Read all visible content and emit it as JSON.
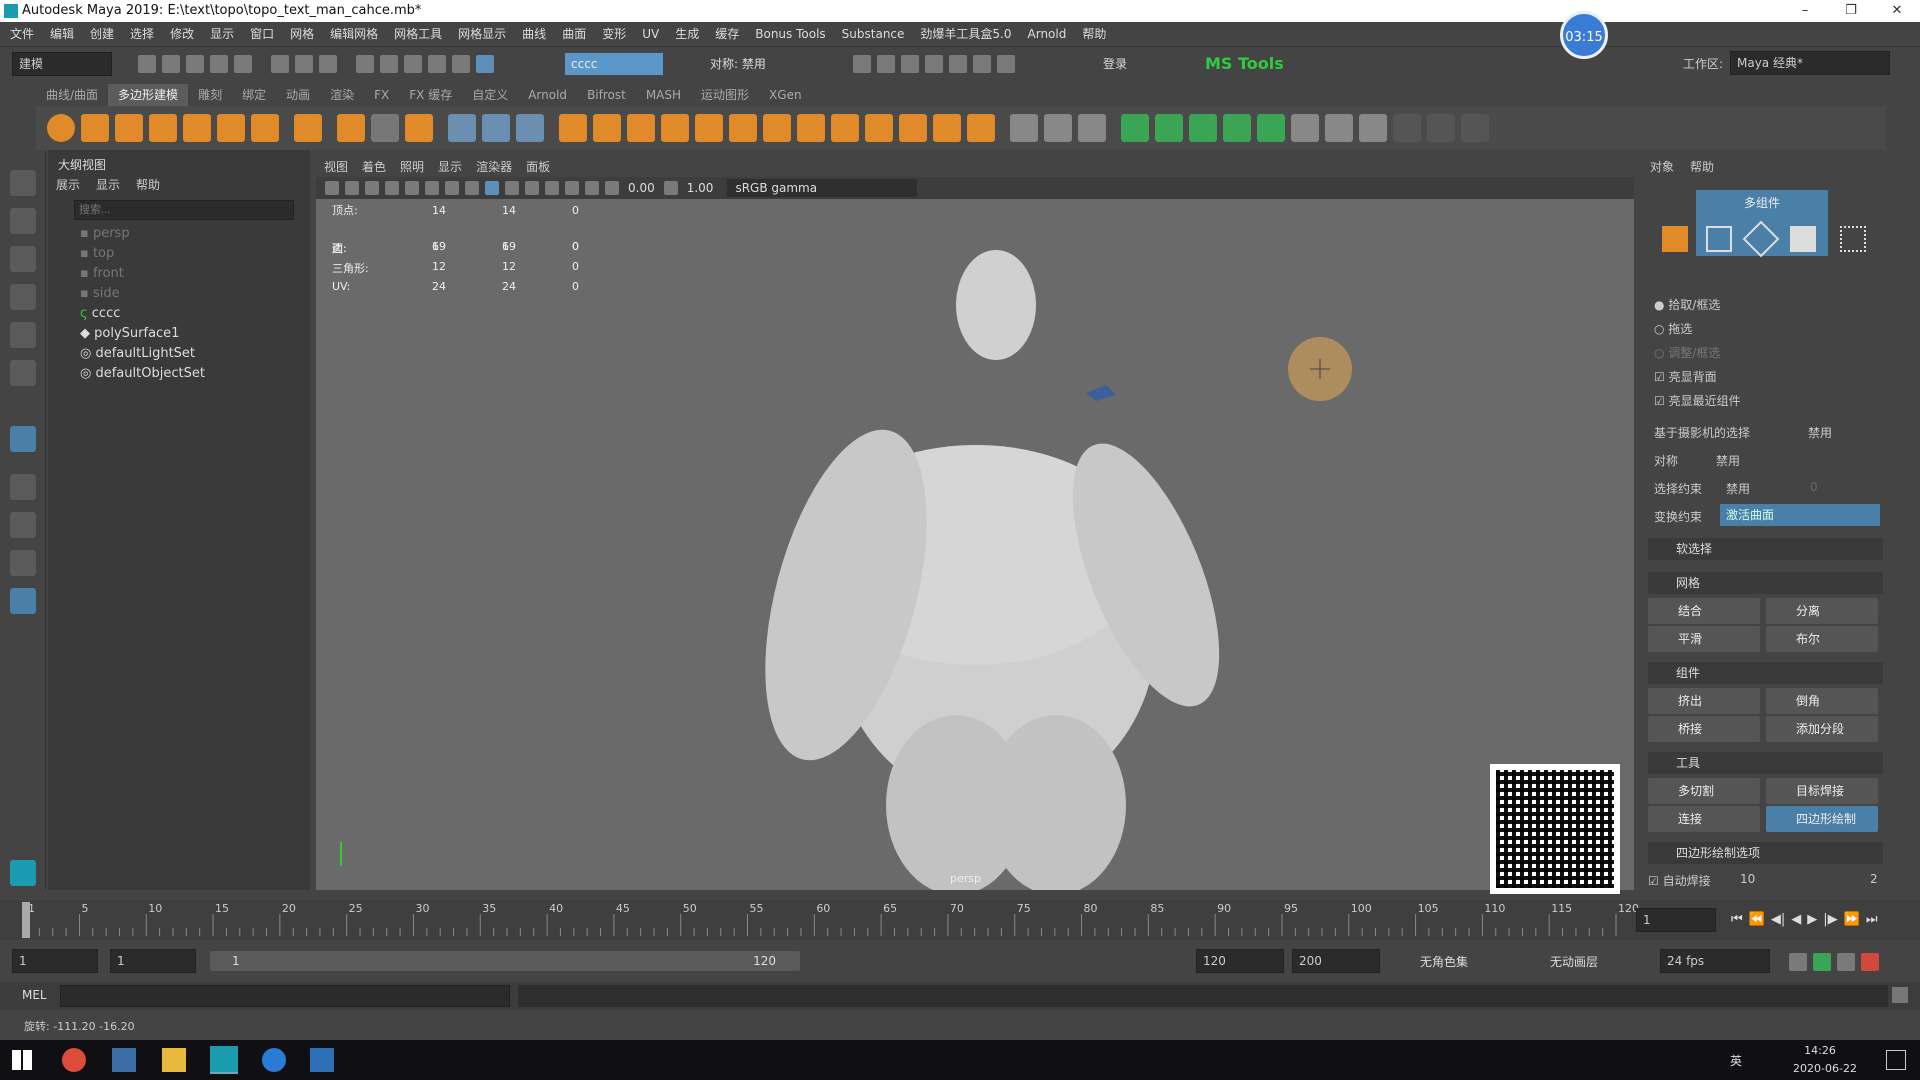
{
  "window": {
    "title": "Autodesk Maya 2019: E:\\text\\topo\\topo_text_man_cahce.mb*"
  },
  "menubar": [
    "文件",
    "编辑",
    "创建",
    "选择",
    "修改",
    "显示",
    "窗口",
    "网格",
    "编辑网格",
    "网格工具",
    "网格显示",
    "曲线",
    "曲面",
    "变形",
    "UV",
    "生成",
    "缓存",
    "Bonus Tools",
    "Substance",
    "劲爆羊工具盒5.0",
    "Arnold",
    "帮助"
  ],
  "status": {
    "mode": "建模",
    "sym_label": "对称: 禁用",
    "field": "cccc",
    "login": "登录",
    "mstools": "MS Tools",
    "timer": "03:15",
    "workspace_label": "工作区:",
    "workspace_value": "Maya 经典*"
  },
  "shelf_tabs": [
    "曲线/曲面",
    "多边形建模",
    "雕刻",
    "绑定",
    "动画",
    "渲染",
    "FX",
    "FX 缓存",
    "自定义",
    "Arnold",
    "Bifrost",
    "MASH",
    "运动图形",
    "XGen"
  ],
  "shelf_active": "多边形建模",
  "outliner": {
    "title": "大纲视图",
    "menu": [
      "展示",
      "显示",
      "帮助"
    ],
    "search_placeholder": "搜索...",
    "items": [
      "persp",
      "top",
      "front",
      "side",
      "cccc",
      "polySurface1",
      "defaultLightSet",
      "defaultObjectSet"
    ]
  },
  "viewport": {
    "menu": [
      "视图",
      "着色",
      "照明",
      "显示",
      "渲染器",
      "面板"
    ],
    "val1": "0.00",
    "val2": "1.00",
    "colorspace": "sRGB gamma",
    "camera_label": "persp",
    "hud_rows": [
      {
        "label": "顶点:",
        "a": "14",
        "b": "14",
        "c": "0"
      },
      {
        "label": "边:",
        "a": "19",
        "b": "19",
        "c": "0"
      },
      {
        "label": "面:",
        "a": "6",
        "b": "6",
        "c": "0"
      },
      {
        "label": "三角形:",
        "a": "12",
        "b": "12",
        "c": "0"
      },
      {
        "label": "UV:",
        "a": "24",
        "b": "24",
        "c": "0"
      }
    ]
  },
  "right_panel": {
    "menu": [
      "对象",
      "帮助"
    ],
    "mode_label": "多组件",
    "radios": [
      "拾取/框选",
      "拖选",
      "调整/框选"
    ],
    "checks": [
      "亮显背面",
      "亮显最近组件"
    ],
    "camera_sel": "基于摄影机的选择",
    "camera_sel_val": "禁用",
    "symmetry": "对称",
    "symmetry_val": "禁用",
    "sel_constraint": "选择约束",
    "sel_constraint_val": "禁用",
    "sel_constraint_num": "0",
    "transform_constraint": "变换约束",
    "transform_value": "激活曲面",
    "soft_sel": "软选择",
    "sec_mesh": "网格",
    "btn_combine": "结合",
    "btn_separate": "分离",
    "btn_smooth": "平滑",
    "btn_boolean": "布尔",
    "sec_components": "组件",
    "btn_extrude": "挤出",
    "btn_bevel": "倒角",
    "btn_bridge": "桥接",
    "btn_add_div": "添加分段",
    "sec_tools": "工具",
    "btn_multicut": "多切割",
    "btn_target_weld": "目标焊接",
    "btn_connect": "连接",
    "btn_quad_draw": "四边形绘制",
    "sec_quad_opts": "四边形绘制选项",
    "auto_weld": "自动焊接",
    "auto_weld_val": "10",
    "auto_weld_val2": "2"
  },
  "timeline": {
    "ticks": [
      "1",
      "5",
      "10",
      "15",
      "20",
      "25",
      "30",
      "35",
      "40",
      "45",
      "50",
      "55",
      "60",
      "65",
      "70",
      "75",
      "80",
      "85",
      "90",
      "95",
      "100",
      "105",
      "110",
      "115",
      "120"
    ],
    "current": "1"
  },
  "range": {
    "start": "1",
    "start2": "1",
    "slider_start": "1",
    "slider_end": "120",
    "end": "120",
    "end2": "200",
    "charset": "无角色集",
    "anim_layer": "无动画层",
    "fps": "24 fps"
  },
  "cmdline": {
    "label": "MEL"
  },
  "helpline": {
    "text": "旋转: -111.20  -16.20"
  },
  "taskbar": {
    "time": "14:26",
    "date": "2020-06-22",
    "lang": "英"
  }
}
